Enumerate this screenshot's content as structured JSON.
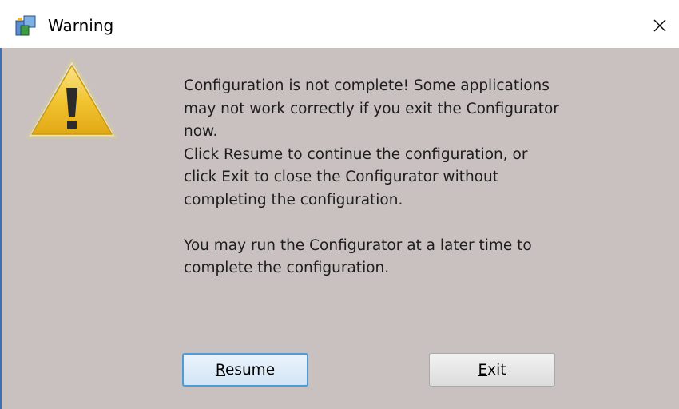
{
  "window": {
    "title": "Warning",
    "icon": "configurator-app-icon",
    "close_icon": "close-x-icon"
  },
  "dialog": {
    "icon": "warning-triangle-icon",
    "message_lines": [
      "Configuration is not complete! Some applications",
      "may not work correctly if you exit the Configurator",
      "now.",
      "Click Resume to continue the configuration, or",
      "click Exit to close the Configurator without",
      "completing the configuration."
    ],
    "message_lines_2": [
      "You may run the Configurator at a later time to",
      "complete the configuration."
    ]
  },
  "buttons": {
    "resume": {
      "mnemonic": "R",
      "rest": "esume"
    },
    "exit": {
      "mnemonic": "E",
      "rest": "xit"
    }
  },
  "colors": {
    "client_background": "#c9c1bf",
    "default_button_border": "#4f9ad9",
    "warning_yellow": "#f2c531"
  }
}
